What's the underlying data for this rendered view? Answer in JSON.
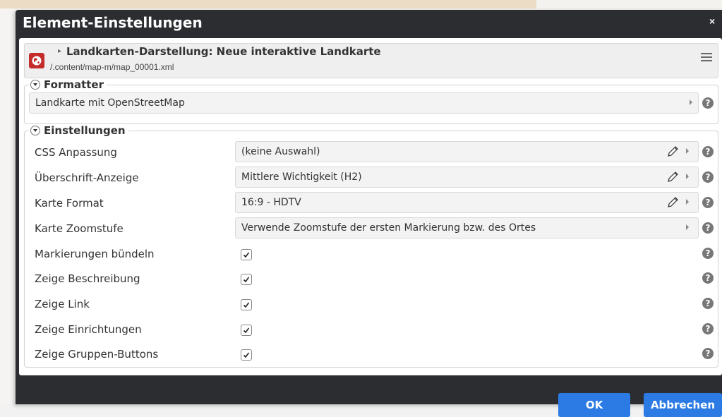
{
  "dialog": {
    "title": "Element-Einstellungen",
    "close_label": "×"
  },
  "header": {
    "title": "Landkarten-Darstellung: Neue interaktive Landkarte",
    "path": "/.content/map-m/map_00001.xml"
  },
  "formatter": {
    "legend": "Formatter",
    "value": "Landkarte mit OpenStreetMap"
  },
  "settings": {
    "legend": "Einstellungen",
    "selects": [
      {
        "label": "CSS Anpassung",
        "value": "(keine Auswahl)",
        "editable": true
      },
      {
        "label": "Überschrift-Anzeige",
        "value": "Mittlere Wichtigkeit (H2)",
        "editable": true
      },
      {
        "label": "Karte Format",
        "value": "16:9 - HDTV",
        "editable": true
      },
      {
        "label": "Karte Zoomstufe",
        "value": "Verwende Zoomstufe der ersten Markierung bzw. des Ortes",
        "editable": false
      }
    ],
    "checkboxes": [
      {
        "label": "Markierungen bündeln",
        "checked": true
      },
      {
        "label": "Zeige Beschreibung",
        "checked": true
      },
      {
        "label": "Zeige Link",
        "checked": true
      },
      {
        "label": "Zeige Einrichtungen",
        "checked": true
      },
      {
        "label": "Zeige Gruppen-Buttons",
        "checked": true
      }
    ]
  },
  "footer": {
    "ok_label": "OK",
    "cancel_label": "Abbrechen"
  },
  "colors": {
    "dialog_bg": "#2b2d31",
    "button_blue": "#2c7be5",
    "icon_red": "#c42b2b"
  },
  "icons": [
    "map-type-icon",
    "menu-icon",
    "collapse-toggle-icon",
    "pencil-icon",
    "arrow-right-icon",
    "help-icon",
    "checkmark-icon"
  ]
}
